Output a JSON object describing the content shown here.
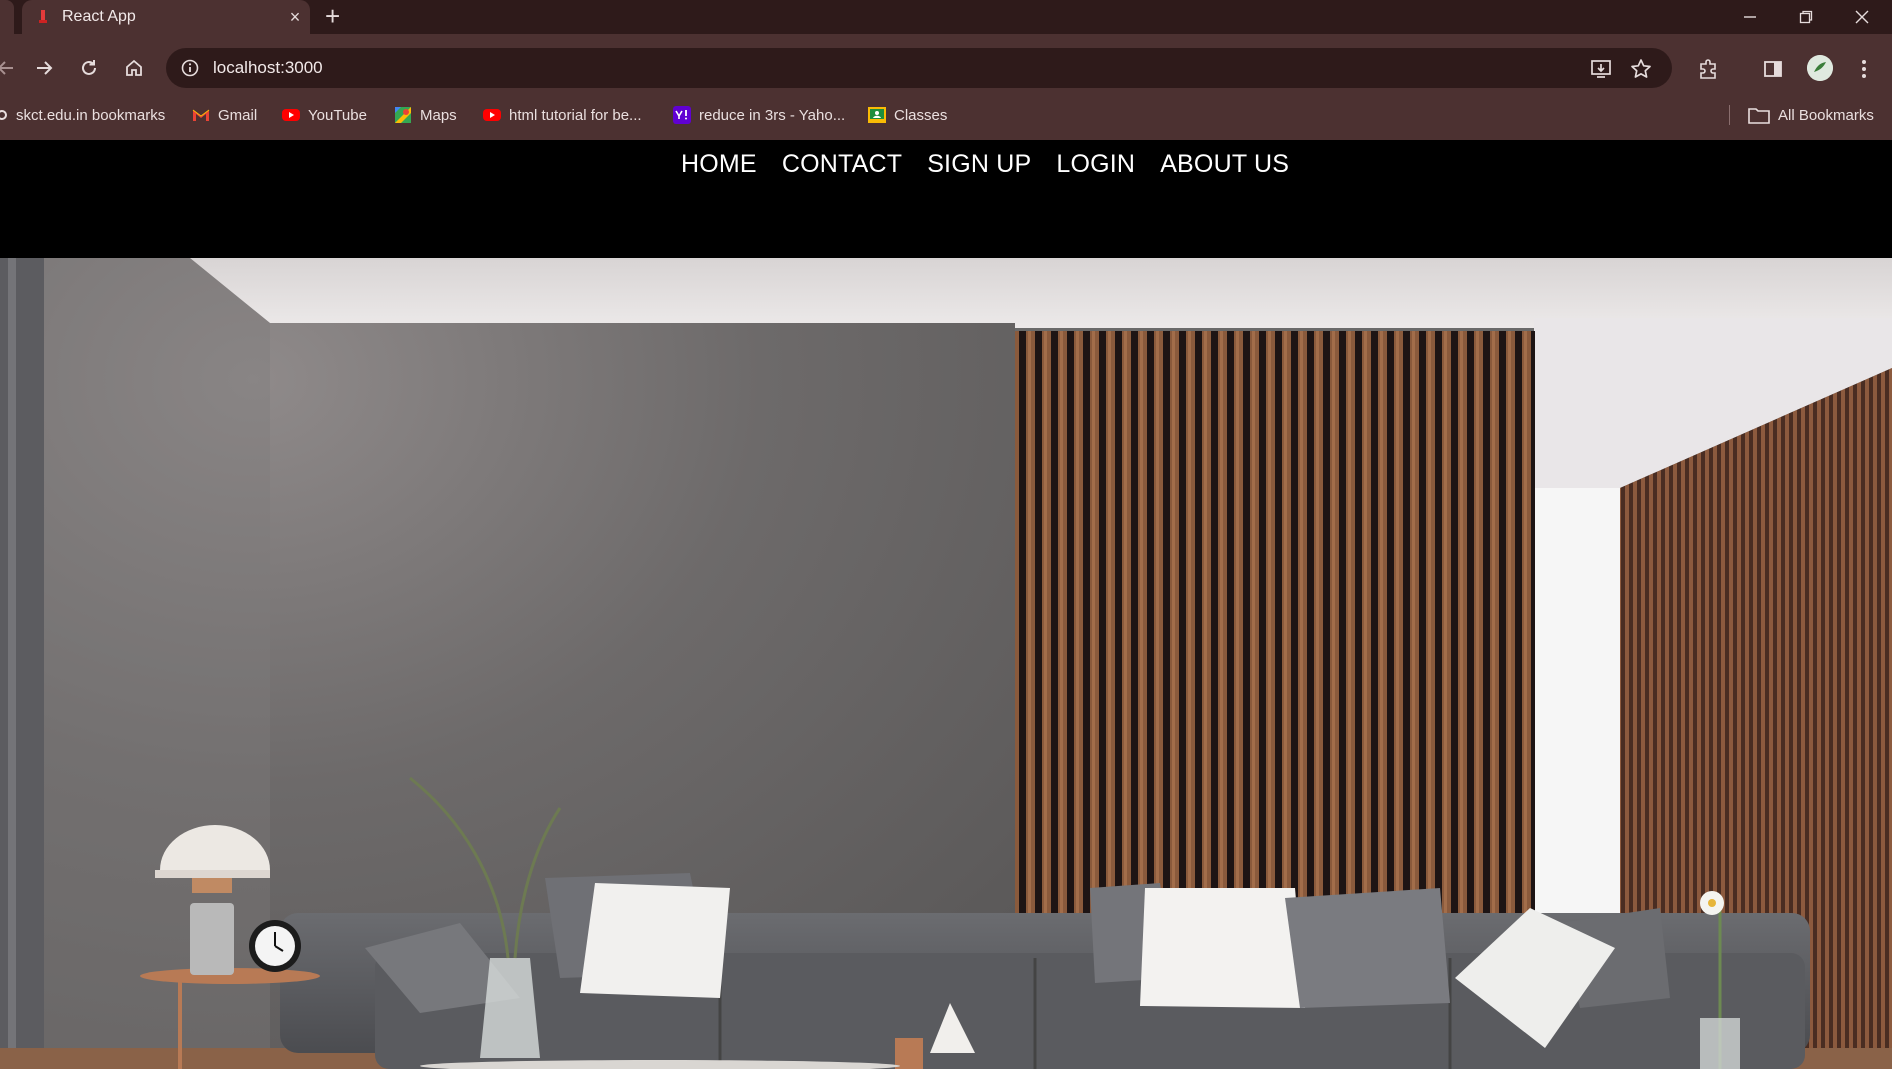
{
  "browser": {
    "tab": {
      "title": "React App"
    },
    "address": {
      "url": "localhost:3000"
    },
    "bookmarks": [
      {
        "label": "skct.edu.in bookmarks",
        "icon": "gear-icon"
      },
      {
        "label": "Gmail",
        "icon": "gmail-icon"
      },
      {
        "label": "YouTube",
        "icon": "youtube-icon"
      },
      {
        "label": "Maps",
        "icon": "maps-icon"
      },
      {
        "label": "html tutorial for be...",
        "icon": "youtube-icon"
      },
      {
        "label": "reduce in 3rs - Yaho...",
        "icon": "yahoo-icon"
      },
      {
        "label": "Classes",
        "icon": "classroom-icon"
      }
    ],
    "all_bookmarks": "All Bookmarks",
    "colors": {
      "frame": "#2e1a1a",
      "toolbar": "#4c3131",
      "text": "#eadfdf"
    }
  },
  "site": {
    "nav": [
      "HOME",
      "CONTACT",
      "SIGN UP",
      "LOGIN",
      "ABOUT US"
    ],
    "hero_image": "living-room-interior-image",
    "colors": {
      "nav_bg": "#000000",
      "nav_text": "#ffffff"
    }
  }
}
